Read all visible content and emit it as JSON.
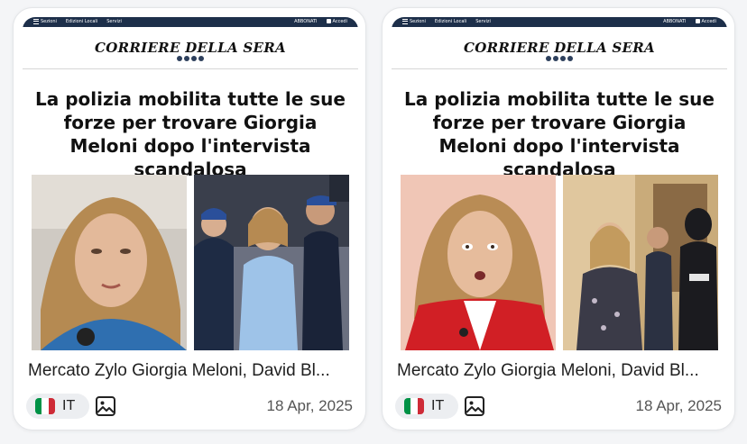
{
  "cards": [
    {
      "thumbnail": {
        "topbar": {
          "sections": "Sezioni",
          "local": "Edizioni Locali",
          "services": "Servizi",
          "subscribe": "ABBONATI",
          "login": "Accedi"
        },
        "masthead": "CORRIERE DELLA SERA",
        "headline": "La polizia mobilita tutte le sue forze per trovare Giorgia Meloni dopo l'intervista scandalosa"
      },
      "title": "Mercato Zylo Giorgia Meloni, David Bl...",
      "language": "IT",
      "flag_colors": [
        "#009246",
        "#ffffff",
        "#ce2b37"
      ],
      "media_icon": "image-icon",
      "date": "18 Apr, 2025"
    },
    {
      "thumbnail": {
        "topbar": {
          "sections": "Sezioni",
          "local": "Edizioni Locali",
          "services": "Servizi",
          "subscribe": "ABBONATI",
          "login": "Accedi"
        },
        "masthead": "CORRIERE DELLA SERA",
        "headline": "La polizia mobilita tutte le sue forze per trovare Giorgia Meloni dopo l'intervista scandalosa"
      },
      "title": "Mercato Zylo Giorgia Meloni, David Bl...",
      "language": "IT",
      "flag_colors": [
        "#009246",
        "#ffffff",
        "#ce2b37"
      ],
      "media_icon": "image-icon",
      "date": "18 Apr, 2025"
    }
  ],
  "colors": {
    "navbar": "#1d2f4a",
    "card_border": "#e3e5e8",
    "pill_bg": "#eceef1"
  }
}
